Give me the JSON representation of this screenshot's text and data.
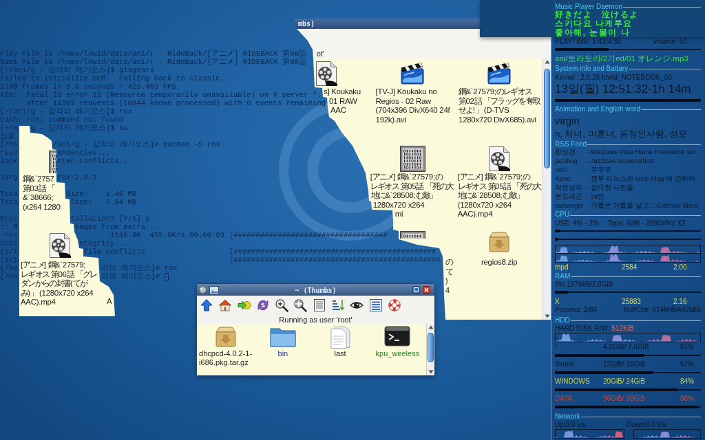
{
  "terminal": {
    "lines": [
      {
        "segments": [
          "Play File is /home/lowid/data/ani/r - RideBack/[アニメ] RIDEBACK 第08話"
        ]
      },
      {
        "segments": [
          "Sami File is /home/lowid/data/ani/r - RideBack/[アニメ] RIDEBACK 第08話"
        ]
      },
      {
        "segments": [
          "[~/ani/g - 강각의 레기오스]$ glxgears"
        ]
      },
      {
        "segments": [
          "Failed to initialize GEM.  Falling back to classic."
        ]
      },
      {
        "segments": [
          "2148 frames in 5.0 seconds = 429.463 FPS"
        ]
      },
      {
        "segments": [
          "XIO:  fatal IO error 11 (Resource temporarily unavailable) on X server \":"
        ]
      },
      {
        "segments": [
          "after 11303 requests (10844 known processed) with 0 events remaining"
        ]
      },
      {
        "segments": [
          "[~/ani/g - 강각의 레기오스]$ rox"
        ]
      },
      {
        "segments": [
          "bash: rox: command not found"
        ]
      },
      {
        "segments": [
          "[~/a",
          "g - 강각의 레기오스]$ su"
        ]
      },
      {
        "segments": [
          "암호"
        ]
      },
      {
        "segments": [
          "[/ho",
          "/ani/g - 강각의 레기오스]# pacman -S rox"
        ]
      },
      {
        "segments": [
          "reso",
          "endencies..."
        ]
      },
      {
        "segments": [
          "look",
          "nter-conflicts..."
        ]
      },
      {
        "segments": [
          "Targ",
          "rox-2.0-1"
        ]
      },
      {
        "segments": [
          "Tota",
          "Size:    1.40 MB"
        ]
      },
      {
        "segments": [
          "Tota",
          "Size:   3.84 MB"
        ]
      },
      {
        "segments": [
          "Proc",
          "tallation? [Y/n] y"
        ]
      },
      {
        "segments": [
          ":: R",
          "kages from extra..."
        ]
      },
      {
        "segments": [
          "rox",
          "1510.9K  455.9K/s 00:00:03 [###################################"
        ]
      },
      {
        "segments": [
          "chec",
          "ntegrity..."
        ]
      },
      {
        "segments": [
          "(1/1",
          "file conflicts",
          "[##############################################"
        ]
      },
      {
        "segments": [
          "(1/1",
          "[###############################################"
        ]
      },
      {
        "segments": [
          "[/ho",
          "각의 레기오스]# rox"
        ]
      },
      {
        "segments": [
          "[/ho",
          "각의 레기오스]#"
        ]
      }
    ]
  },
  "file_window": {
    "title": "mbs)",
    "status": "ot'",
    "items": [
      {
        "kind": "video-reel",
        "label_lines": [
          "s] Koukaku",
          "01 RAW",
          "AAC"
        ]
      },
      {
        "kind": "video-clapper",
        "label_lines": [
          "[TV-J] Koukaku no",
          "Regios - 02 Raw",
          "(704x396 DivX640 24f",
          "192k).avi"
        ]
      },
      {
        "kind": "video-clapper",
        "label_lines": [
          "鋼&`27579;のレギオス",
          "第02話 「フラッグを奪取",
          "せよ!」 (D-TVS",
          "1280x720 DivX685).avi"
        ]
      },
      {
        "kind": "binary",
        "label_lines": [
          "[アニメ] 鋼&`27579;の",
          "レギオス 第05話 「死の大",
          "地に&`28508;む敵」",
          "1280x720 x264",
          "mi"
        ]
      },
      {
        "kind": "video-reel",
        "label_lines": [
          "[アニメ] 鋼&`27579;の",
          "レギオス 第05話 「死の大",
          "地に&`28508;む敵」",
          "(1280x720 x264",
          "AAC).mp4"
        ]
      },
      {
        "kind": "binary",
        "label_lines": [
          "の",
          "て",
          ")",
          "4"
        ]
      },
      {
        "kind": "archive",
        "label_lines": [
          "regios8.zip"
        ]
      }
    ]
  },
  "file_fragment": {
    "items": [
      {
        "kind": "binary",
        "label_lines": [
          "鋼&`2757",
          "第03話 「",
          "&`38666;",
          "(x264 1280"
        ]
      },
      {
        "kind": "video-reel",
        "label_lines": [
          "[アニメ] 鋼&`27579;",
          "レギオス 第06話 「グレ",
          "ダンからの封書(てが",
          "み)」 (1280x720 x264",
          "AAC).mp4"
        ]
      },
      {
        "label_lines": [
          "A"
        ]
      }
    ]
  },
  "thumbs_window": {
    "title": "~ (Thumbs)",
    "status": "Running as user 'root'",
    "items": [
      {
        "kind": "archive",
        "label_lines": [
          "dhcpcd-4.0.2-1-",
          "i686.pkg.tar.gz"
        ]
      },
      {
        "kind": "folder",
        "label_lines": [
          "bin"
        ]
      },
      {
        "kind": "document",
        "label_lines": [
          "last"
        ]
      },
      {
        "kind": "executable",
        "label_lines": [
          "kpu_wireless"
        ]
      }
    ]
  },
  "system_monitor": {
    "mpd": {
      "title": "Music Player Daemon",
      "lyrics": [
        "好きだよ　泣けるよ",
        "스키다요 나케루요",
        "좋아해, 눈물이 나"
      ],
      "playtime": "PLAYTIME: 1:43/4:38",
      "volume": "volume: 50",
      "level": 0.37,
      "song": "ani/토라도라/2기ed/01 オレンジ.mp3"
    },
    "system": {
      "title": "System info and Battary",
      "kernel": "Kernel : 2.6.29-lowid_NOTEBOOK_03",
      "datetime": "13일(월) 12:51:32-1h 14m"
    },
    "word": {
      "title": "Animation and English word",
      "word": "virgin",
      "meaning": "n, 처녀, 미혼녀, 동정인사람, 성모"
    },
    "rss": {
      "title": "RSS Feed",
      "items": [
        {
          "source": "환상경",
          "headline": "- Windows Vista Home PremiumK Scr"
        },
        {
          "source": "jazzbug",
          "headline": "- JazzEee ScreenShot!"
        },
        {
          "source": "cero",
          "headline": "- 쿠쿠쿠"
        },
        {
          "source": "Rano",
          "headline": "- 젠투 리눅스의 USE-Flag 에 관하여"
        },
        {
          "source": "작은상자",
          "headline": "- 잡다한 사진들"
        },
        {
          "source": "본드레곤",
          "headline": "- 28만"
        },
        {
          "source": "sakuragis",
          "headline": "- 거룹은 거룹을 낳고... External Stora"
        }
      ]
    },
    "cpu": {
      "title": "CPU",
      "usage": "USE: 4% - 2%",
      "type": "Type: i686 - 2095MHz X2",
      "cores": [
        {
          "level": 0.04
        },
        {
          "level": 0.02
        }
      ],
      "top": {
        "name": "mpd",
        "pid": "2584",
        "cpu": "2.00"
      }
    },
    "ram": {
      "title": "RAM",
      "usage": "9% 197MiB/2.0GiB",
      "level": 0.09,
      "top": {
        "name": "X",
        "pid": "25883",
        "cpu": "2.16"
      },
      "processes": "Process: 2/84",
      "buffers": "Buf/Che: 614MiB/492MiB"
    },
    "hdd": {
      "title": "HDD",
      "rw_label": "HARD DISK R/W:",
      "rw_value": "512KiB",
      "disks": [
        {
          "mount": "/",
          "usage": "4.2GiB/ 7.6GiB",
          "percent": "61%",
          "level": 0.61,
          "color": "#0b1726"
        },
        {
          "mount": "/home",
          "usage": "12GiB/ 19GiB",
          "percent": "67%",
          "level": 0.67,
          "color": "#0b1726"
        },
        {
          "mount": "WINDOWS",
          "usage": "20GiB/ 24GiB",
          "percent": "84%",
          "level": 0.84,
          "color": "#c9cf45"
        },
        {
          "mount": "DATA",
          "usage": "96GiB/ 98GiB",
          "percent": "98%",
          "level": 0.98,
          "color": "#c2453c"
        }
      ]
    },
    "network": {
      "title": "Network",
      "up": "Up:0.0 k/s",
      "down": "Down:0.0 k/s"
    }
  }
}
